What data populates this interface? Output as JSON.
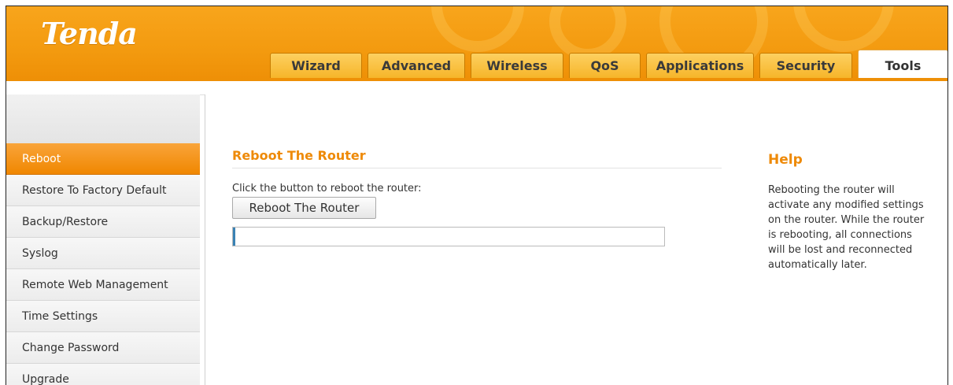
{
  "header": {
    "logo": "Tenda",
    "tabs": [
      {
        "label": "Wizard"
      },
      {
        "label": "Advanced"
      },
      {
        "label": "Wireless"
      },
      {
        "label": "QoS"
      },
      {
        "label": "Applications"
      },
      {
        "label": "Security"
      },
      {
        "label": "Tools",
        "active": true
      }
    ]
  },
  "sidebar": {
    "items": [
      {
        "label": "Reboot",
        "active": true
      },
      {
        "label": "Restore To Factory Default"
      },
      {
        "label": "Backup/Restore"
      },
      {
        "label": "Syslog"
      },
      {
        "label": "Remote Web Management"
      },
      {
        "label": "Time Settings"
      },
      {
        "label": "Change Password"
      },
      {
        "label": "Upgrade"
      }
    ]
  },
  "main": {
    "title": "Reboot The Router",
    "description": "Click the button to reboot the router:",
    "reboot_button": "Reboot The Router",
    "progress": 0.005
  },
  "help": {
    "title": "Help",
    "text": "Rebooting the router will activate any modified settings on the router. While the router is rebooting, all connections will be lost and reconnected automatically later."
  },
  "colors": {
    "header_orange": "#f39a0f",
    "accent_orange": "#ee8a08",
    "progress_blue": "#3a82b4"
  }
}
